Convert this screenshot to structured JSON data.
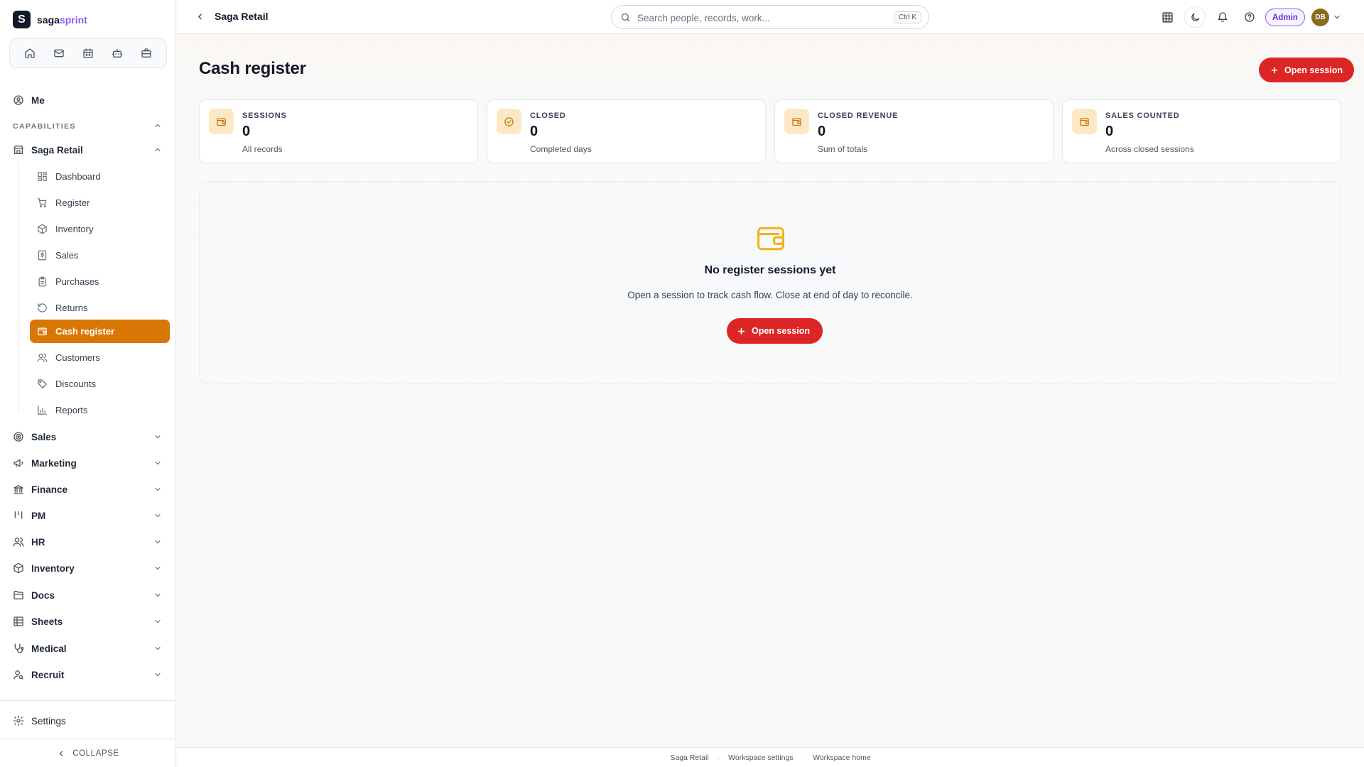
{
  "brand": {
    "logo_letter": "S",
    "name_main": "saga",
    "name_accent": "sprint"
  },
  "quick_icons": [
    "home-icon",
    "mail-icon",
    "calendar-icon",
    "bot-icon",
    "briefcase-icon"
  ],
  "sidebar": {
    "me_label": "Me",
    "capabilities_label": "CAPABILITIES",
    "group_label": "Saga Retail",
    "sub_items": [
      {
        "label": "Dashboard",
        "icon": "dashboard-icon"
      },
      {
        "label": "Register",
        "icon": "cart-icon"
      },
      {
        "label": "Inventory",
        "icon": "box-icon"
      },
      {
        "label": "Sales",
        "icon": "receipt-icon"
      },
      {
        "label": "Purchases",
        "icon": "clipboard-icon"
      },
      {
        "label": "Returns",
        "icon": "undo-icon"
      },
      {
        "label": "Cash register",
        "icon": "wallet-icon",
        "active": true
      },
      {
        "label": "Customers",
        "icon": "users-icon"
      },
      {
        "label": "Discounts",
        "icon": "tag-icon"
      },
      {
        "label": "Reports",
        "icon": "bar-chart-icon"
      }
    ],
    "modules": [
      {
        "label": "Sales",
        "icon": "target-icon"
      },
      {
        "label": "Marketing",
        "icon": "megaphone-icon"
      },
      {
        "label": "Finance",
        "icon": "bank-icon"
      },
      {
        "label": "PM",
        "icon": "kanban-icon"
      },
      {
        "label": "HR",
        "icon": "people-icon"
      },
      {
        "label": "Inventory",
        "icon": "box-icon"
      },
      {
        "label": "Docs",
        "icon": "folder-icon"
      },
      {
        "label": "Sheets",
        "icon": "table-icon"
      },
      {
        "label": "Medical",
        "icon": "stethoscope-icon"
      },
      {
        "label": "Recruit",
        "icon": "user-search-icon"
      }
    ],
    "settings_label": "Settings",
    "collapse_label": "COLLAPSE"
  },
  "topbar": {
    "breadcrumb": "Saga Retail",
    "search_placeholder": "Search people, records, work...",
    "search_shortcut": "Ctrl K",
    "admin_label": "Admin",
    "avatar_initials": "DB"
  },
  "page": {
    "title": "Cash register",
    "open_session_label": "Open session",
    "stats": [
      {
        "caption": "SESSIONS",
        "value": "0",
        "sub": "All records",
        "icon": "wallet-icon"
      },
      {
        "caption": "CLOSED",
        "value": "0",
        "sub": "Completed days",
        "icon": "check-circle-icon"
      },
      {
        "caption": "CLOSED REVENUE",
        "value": "0",
        "sub": "Sum of totals",
        "icon": "wallet-icon"
      },
      {
        "caption": "SALES COUNTED",
        "value": "0",
        "sub": "Across closed sessions",
        "icon": "wallet-icon"
      }
    ],
    "empty_state": {
      "title": "No register sessions yet",
      "description": "Open a session to track cash flow. Close at end of day to reconcile.",
      "button_label": "Open session"
    }
  },
  "footer": {
    "links": [
      "Saga Retail",
      "Workspace settings",
      "Workspace home"
    ]
  },
  "colors": {
    "accent": "#d97706",
    "primary_button": "#dc2626",
    "brand_accent": "#8b5cf6",
    "stat_badge_bg": "#fde8c6",
    "empty_icon": "#f3b31b"
  }
}
